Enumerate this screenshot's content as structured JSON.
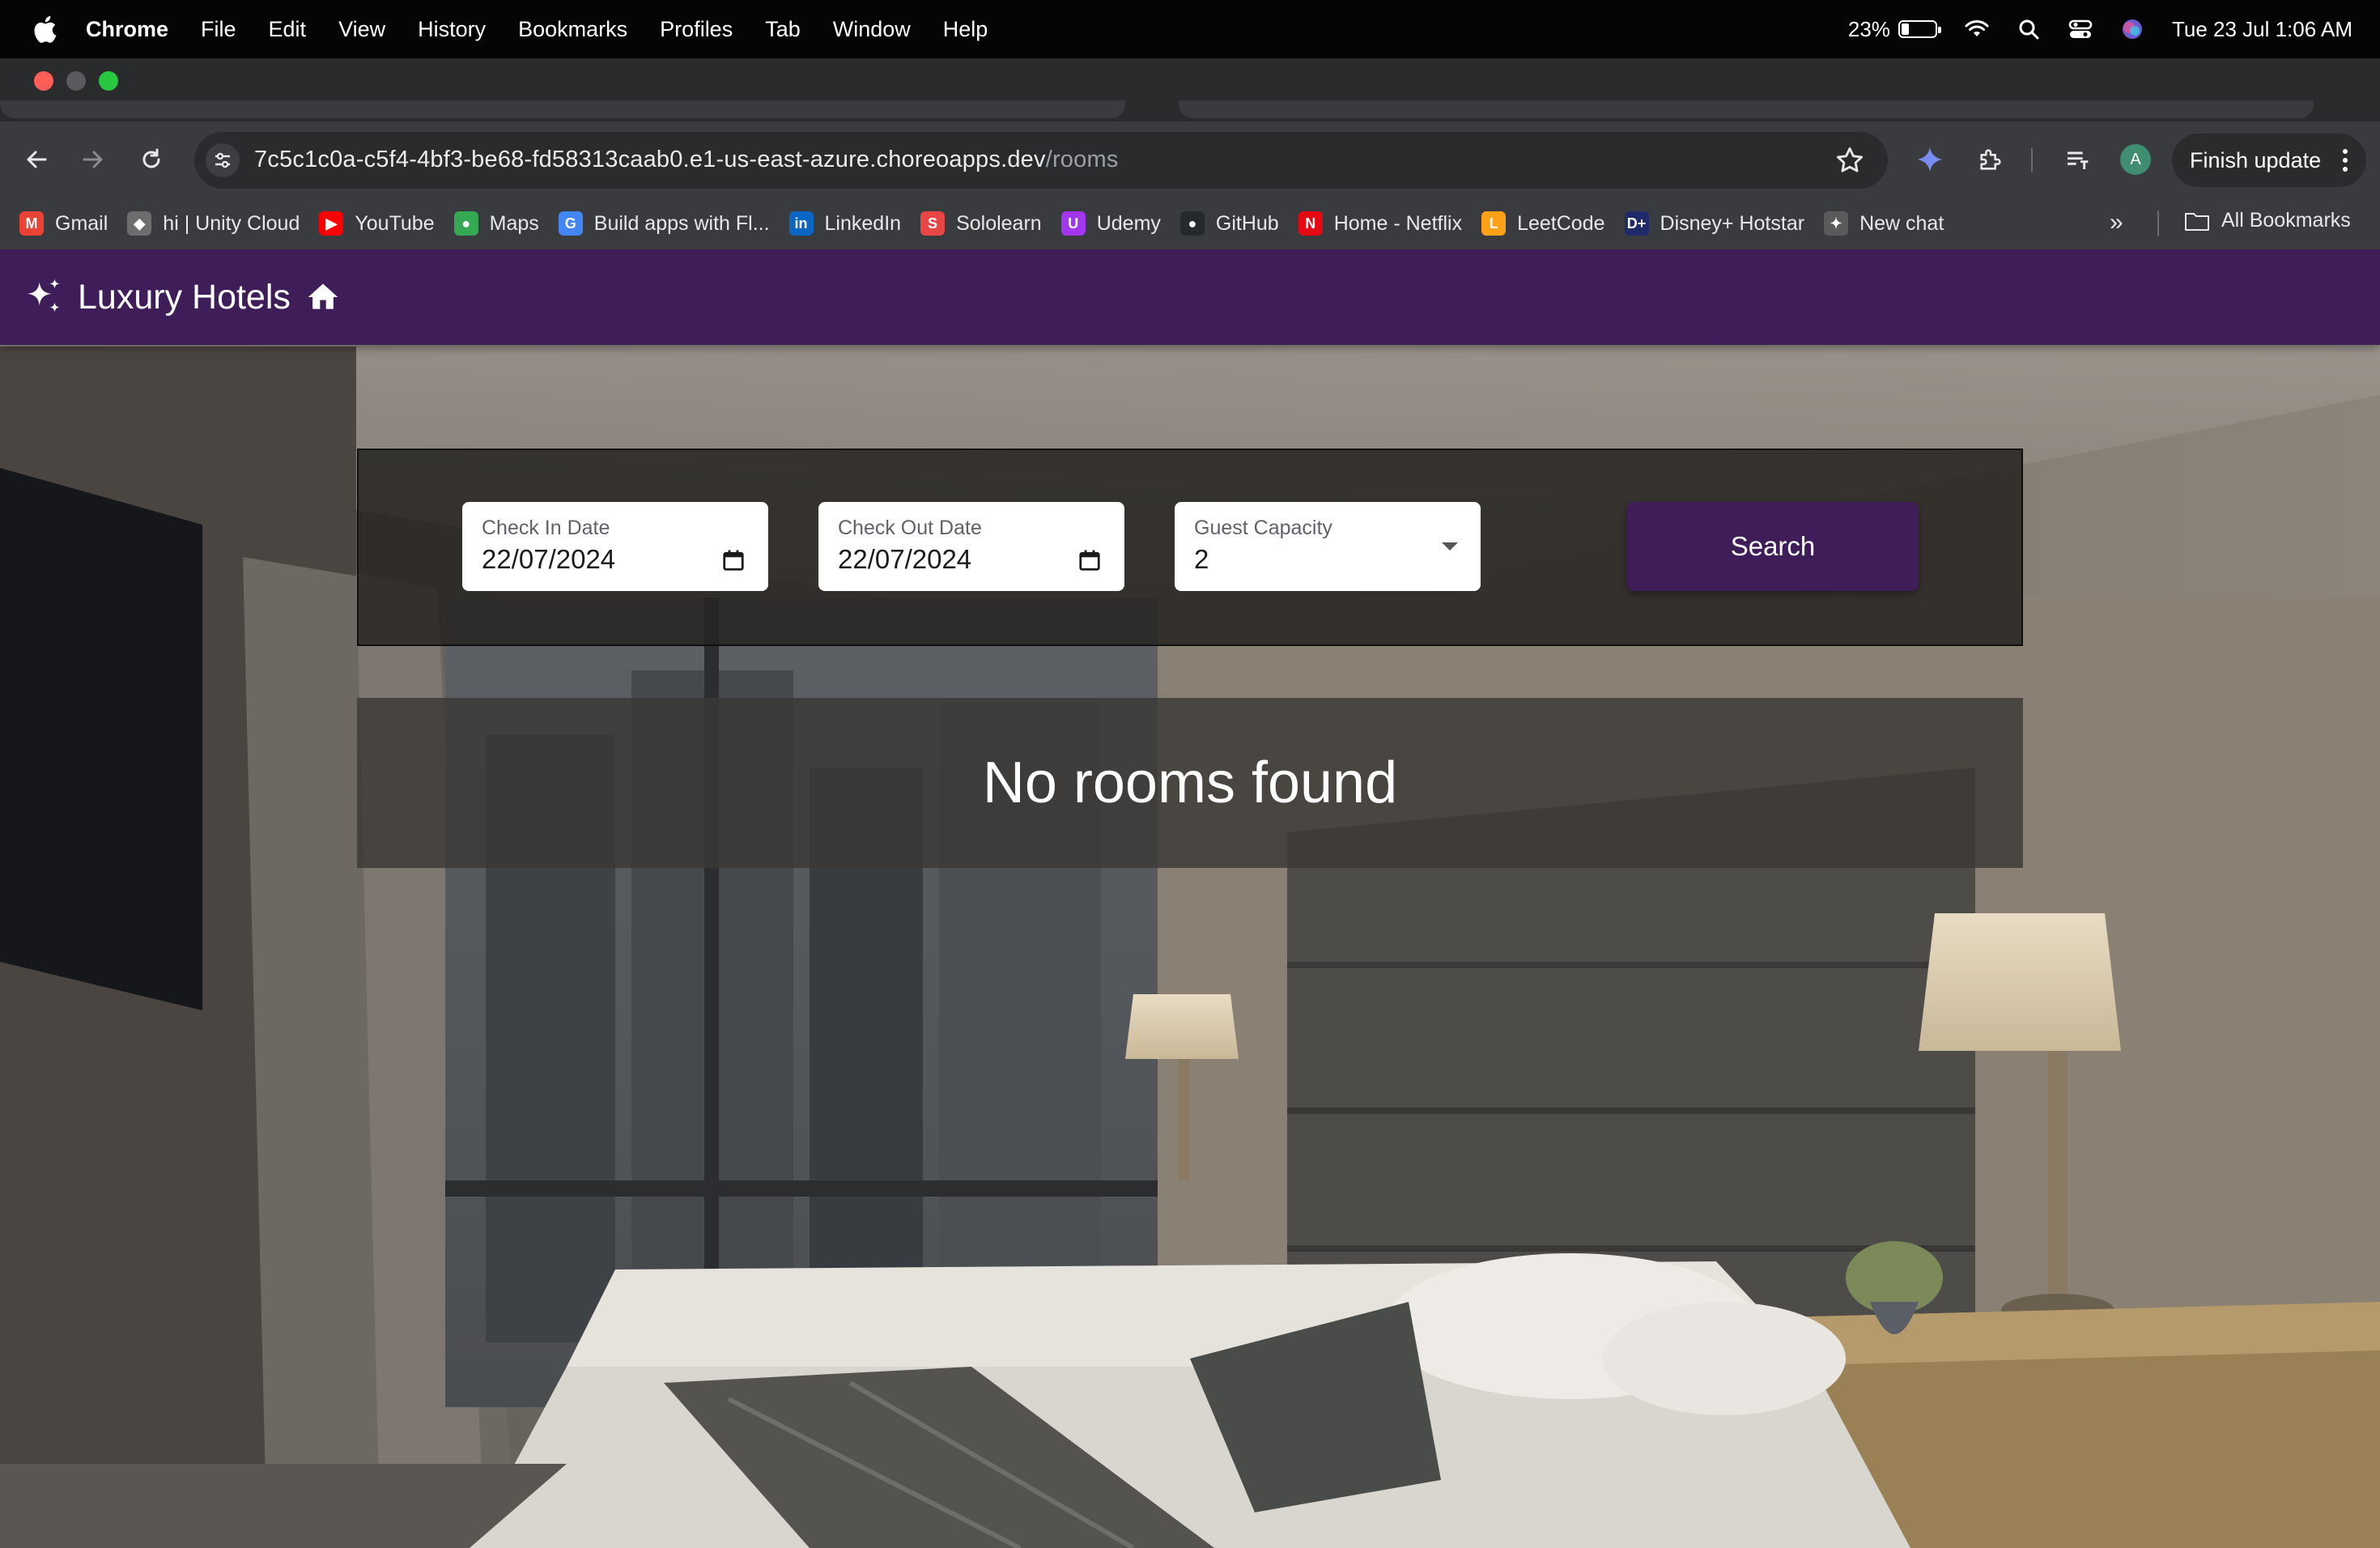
{
  "menubar": {
    "app": "Chrome",
    "items": [
      "File",
      "Edit",
      "View",
      "History",
      "Bookmarks",
      "Profiles",
      "Tab",
      "Window",
      "Help"
    ],
    "battery": "23%",
    "battery_level": 0.23,
    "datetime": "Tue 23 Jul  1:06 AM"
  },
  "browser": {
    "url_host": "7c5c1c0a-c5f4-4bf3-be68-fd58313caab0.e1-us-east-azure.choreoapps.dev",
    "url_path": "/rooms",
    "profile_initial": "A",
    "finish_update": "Finish update",
    "bookmarks": [
      {
        "label": "Gmail",
        "icon": "gmail-icon",
        "color": "#ea4335",
        "glyph": "M"
      },
      {
        "label": "hi | Unity Cloud",
        "icon": "unity-icon",
        "color": "#6d6d6d",
        "glyph": "◆"
      },
      {
        "label": "YouTube",
        "icon": "youtube-icon",
        "color": "#ff0000",
        "glyph": "▶"
      },
      {
        "label": "Maps",
        "icon": "maps-icon",
        "color": "#34a853",
        "glyph": "●"
      },
      {
        "label": "Build apps with Fl...",
        "icon": "google-icon",
        "color": "#4285f4",
        "glyph": "G"
      },
      {
        "label": "LinkedIn",
        "icon": "linkedin-icon",
        "color": "#0a66c2",
        "glyph": "in"
      },
      {
        "label": "Sololearn",
        "icon": "sololearn-icon",
        "color": "#e84545",
        "glyph": "S"
      },
      {
        "label": "Udemy",
        "icon": "udemy-icon",
        "color": "#a435f0",
        "glyph": "U"
      },
      {
        "label": "GitHub",
        "icon": "github-icon",
        "color": "#24292e",
        "glyph": "●"
      },
      {
        "label": "Home - Netflix",
        "icon": "netflix-icon",
        "color": "#e50914",
        "glyph": "N"
      },
      {
        "label": "LeetCode",
        "icon": "leetcode-icon",
        "color": "#ffa116",
        "glyph": "L"
      },
      {
        "label": "Disney+ Hotstar",
        "icon": "hotstar-icon",
        "color": "#1f2a6b",
        "glyph": "D+"
      },
      {
        "label": "New chat",
        "icon": "chatgpt-icon",
        "color": "#5a5a5a",
        "glyph": "✦"
      }
    ],
    "all_bookmarks": "All Bookmarks"
  },
  "app": {
    "brand": "Luxury Hotels",
    "search": {
      "check_in_label": "Check In Date",
      "check_in_value": "22/07/2024",
      "check_out_label": "Check Out Date",
      "check_out_value": "22/07/2024",
      "guest_label": "Guest Capacity",
      "guest_value": "2",
      "button": "Search"
    },
    "result_message": "No rooms found"
  },
  "colors": {
    "appbar": "#3f1d59",
    "search_button": "#3f1d59"
  }
}
